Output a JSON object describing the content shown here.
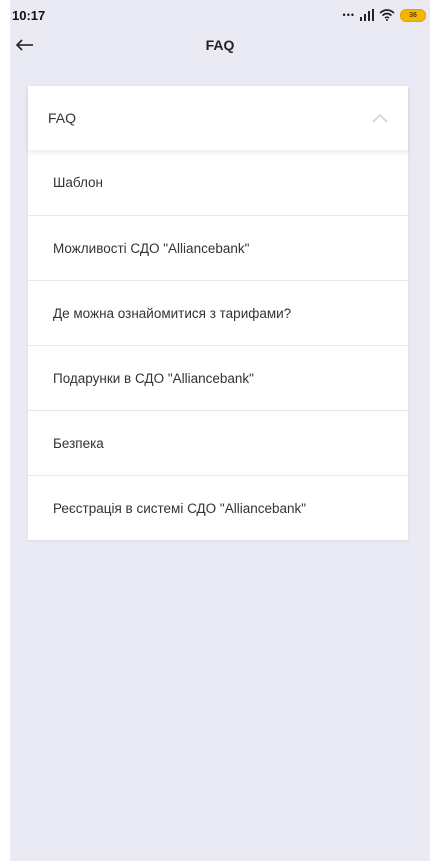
{
  "status_bar": {
    "time": "10:17",
    "signal_dots": "•••",
    "battery_level": "36"
  },
  "header": {
    "back_icon": "arrow-left-icon",
    "title": "FAQ"
  },
  "faq_section": {
    "title": "FAQ",
    "toggle_icon": "chevron-up-icon",
    "expanded": true,
    "items": [
      {
        "label": "Шаблон"
      },
      {
        "label": "Можливості СДО \"Alliancebank\""
      },
      {
        "label": "Де можна ознайомитися з тарифами?"
      },
      {
        "label": "Подарунки в СДО \"Alliancebank\""
      },
      {
        "label": "Безпека"
      },
      {
        "label": "Реєстрація в системі СДО \"Alliancebank\""
      }
    ]
  },
  "colors": {
    "background": "#e9eaf3",
    "card": "#ffffff",
    "battery": "#f2b600"
  }
}
